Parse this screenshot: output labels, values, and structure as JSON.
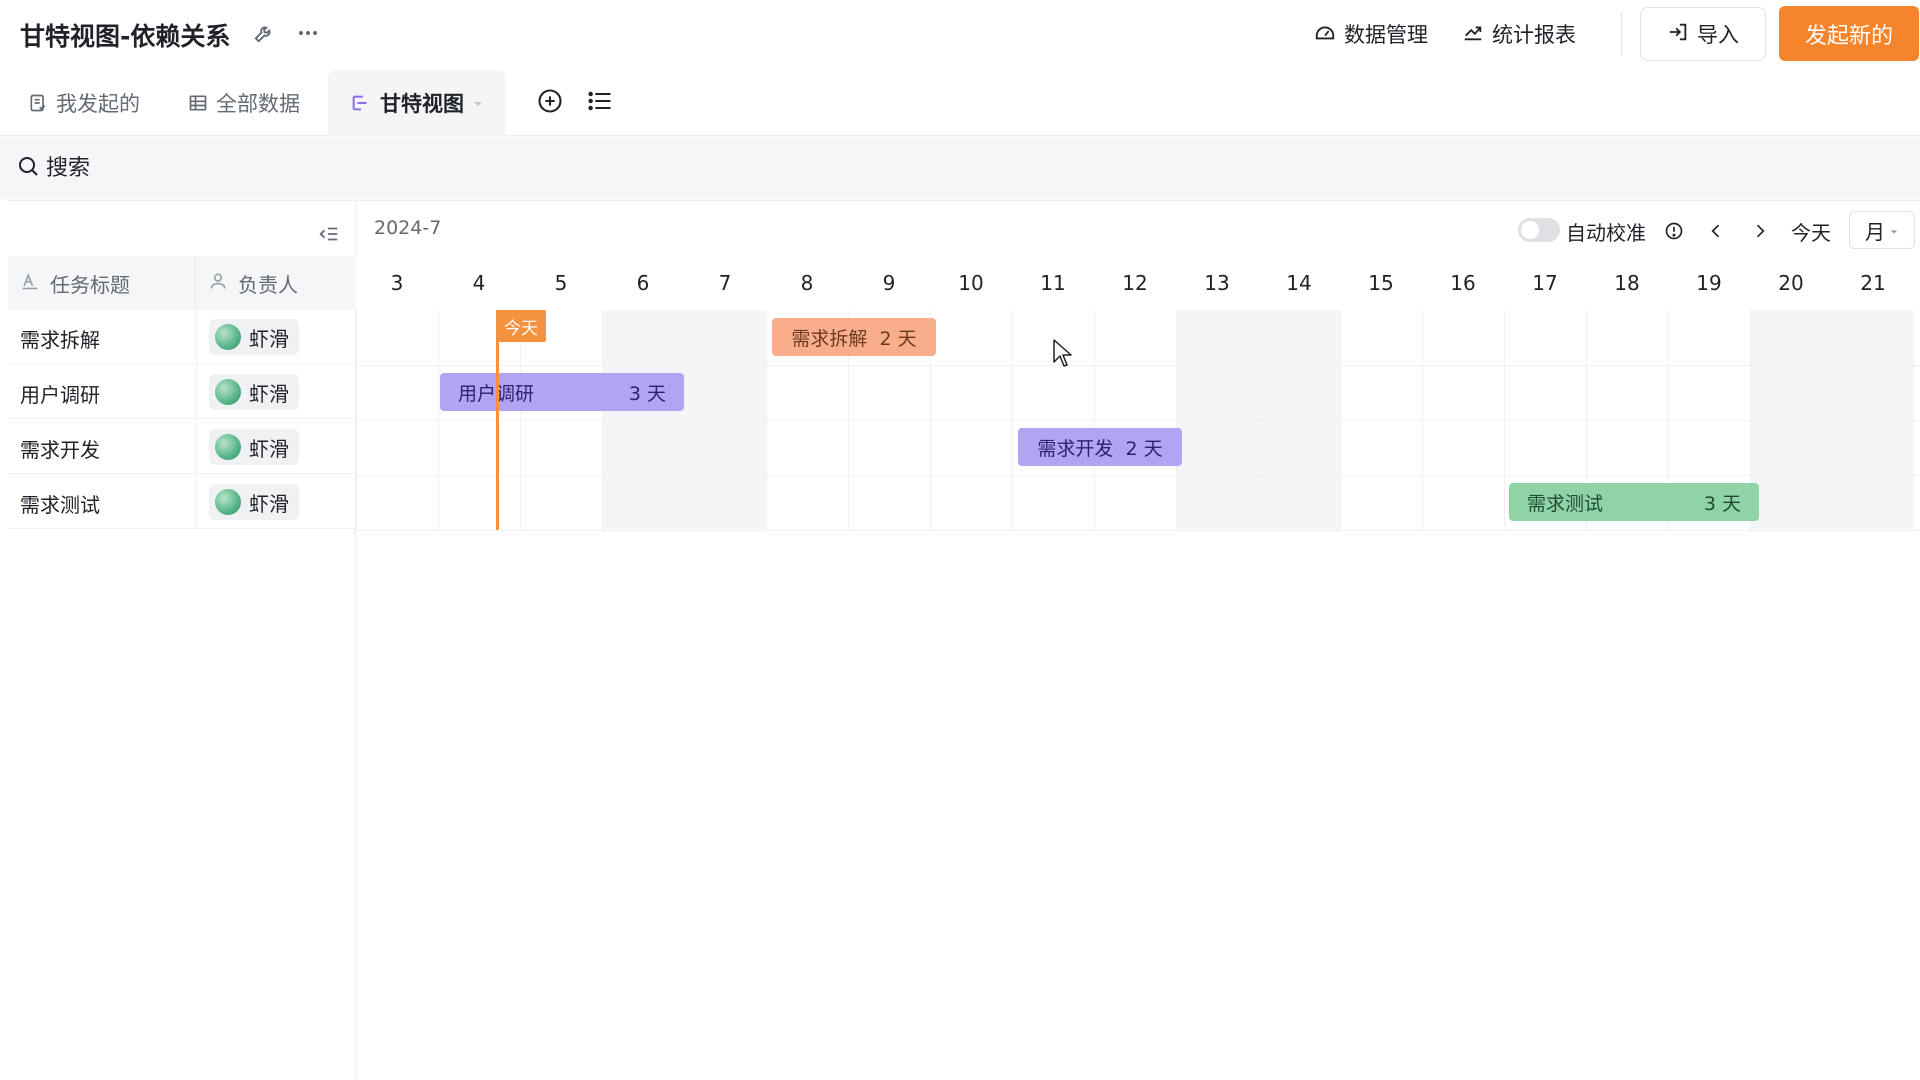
{
  "header": {
    "title": "甘特视图-依赖关系",
    "data_manage": "数据管理",
    "stats_report": "统计报表",
    "import": "导入",
    "new": "发起新的"
  },
  "tabs": [
    {
      "label": "我发起的",
      "icon": "form-icon"
    },
    {
      "label": "全部数据",
      "icon": "table-icon"
    },
    {
      "label": "甘特视图",
      "icon": "gantt-icon"
    }
  ],
  "search": {
    "placeholder": "搜索"
  },
  "columns": {
    "task_title": "任务标题",
    "assignee": "负责人"
  },
  "tasks": [
    {
      "title": "需求拆解",
      "assignee": "虾滑"
    },
    {
      "title": "用户调研",
      "assignee": "虾滑"
    },
    {
      "title": "需求开发",
      "assignee": "虾滑"
    },
    {
      "title": "需求测试",
      "assignee": "虾滑"
    }
  ],
  "timeline": {
    "month": "2024-7",
    "auto_align": "自动校准",
    "today_btn": "今天",
    "view_mode": "月",
    "days": [
      "3",
      "4",
      "5",
      "6",
      "7",
      "8",
      "9",
      "10",
      "11",
      "12",
      "13",
      "14",
      "15",
      "16",
      "17",
      "18",
      "19",
      "20",
      "21"
    ],
    "today_tag": "今天"
  },
  "bars": [
    {
      "name": "需求拆解",
      "duration": "2 天",
      "color": "#f8ae8a"
    },
    {
      "name": "用户调研",
      "duration": "3 天",
      "color": "#b0a4f3"
    },
    {
      "name": "需求开发",
      "duration": "2 天",
      "color": "#b0a4f3"
    },
    {
      "name": "需求测试",
      "duration": "3 天",
      "color": "#8fd3a7"
    }
  ],
  "colors": {
    "accent": "#f5842c",
    "today": "#f5923f"
  }
}
